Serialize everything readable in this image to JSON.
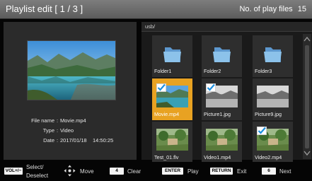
{
  "header": {
    "title": "Playlist edit",
    "page": "[ 1 / 3 ]",
    "play_files_label": "No. of play files",
    "play_files_count": "15"
  },
  "preview": {
    "file_name_label": "File name",
    "file_name": "Movie.mp4",
    "type_label": "Type",
    "type": "Video",
    "date_label": "Date",
    "date": "2017/01/18",
    "time": "14:50:25"
  },
  "browser": {
    "path": "usb/",
    "items": [
      {
        "label": "Folder1",
        "kind": "folder",
        "checked": false,
        "selected": false
      },
      {
        "label": "Folder2",
        "kind": "folder",
        "checked": false,
        "selected": false
      },
      {
        "label": "Folder3",
        "kind": "folder",
        "checked": false,
        "selected": false
      },
      {
        "label": "Movie.mp4",
        "kind": "lake",
        "checked": true,
        "selected": true
      },
      {
        "label": "Picture1.jpg",
        "kind": "bw",
        "checked": true,
        "selected": false
      },
      {
        "label": "Picture9.jpg",
        "kind": "bw",
        "checked": false,
        "selected": false
      },
      {
        "label": "Test_01.flv",
        "kind": "garden",
        "checked": false,
        "selected": false
      },
      {
        "label": "Video1.mp4",
        "kind": "garden",
        "checked": false,
        "selected": false
      },
      {
        "label": "Video2.mp4",
        "kind": "garden",
        "checked": true,
        "selected": false
      }
    ]
  },
  "footer": {
    "vol_key": "VOL+/−",
    "select_line1": "Select/",
    "select_line2": "Deselect",
    "move": "Move",
    "clear_key": "4",
    "clear": "Clear",
    "enter_key": "ENTER",
    "play": "Play",
    "return_key": "RETURN",
    "exit": "Exit",
    "next_key": "6",
    "next": "Next"
  },
  "colors": {
    "selected_tile": "#e8a222",
    "check_blue": "#1c8fe0",
    "folder_blue": "#7fb6e3"
  }
}
